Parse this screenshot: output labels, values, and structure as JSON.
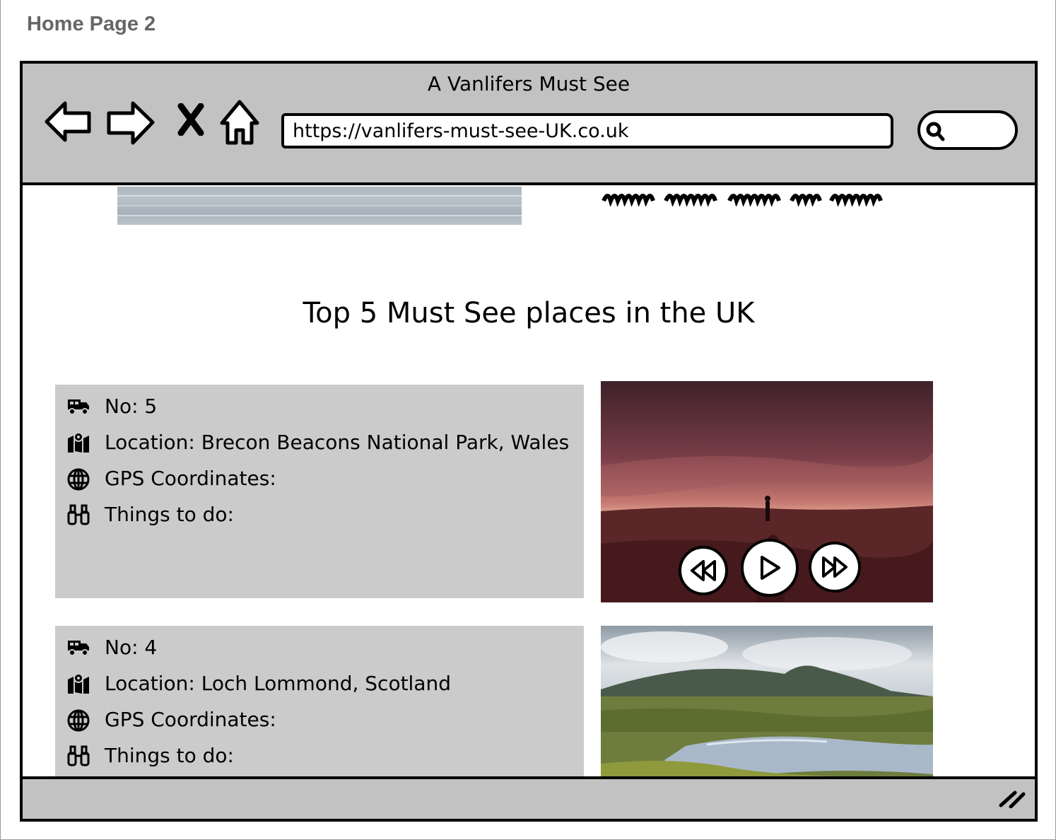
{
  "page": {
    "label": "Home Page 2"
  },
  "browser": {
    "title": "A Vanlifers Must See",
    "url": "https://vanlifers-must-see-UK.co.uk",
    "nav": {
      "back_icon": "arrow-left-icon",
      "forward_icon": "arrow-right-icon",
      "stop_icon": "close-icon",
      "home_icon": "home-icon"
    },
    "search_icon": "search-icon"
  },
  "main": {
    "heading": "Top 5 Must See places in the UK",
    "places": [
      {
        "no": "No: 5",
        "location": "Location: Brecon Beacons National Park, Wales",
        "gps": "GPS Coordinates:",
        "todo": "Things to do:",
        "image": "brecon-beacons-sunset-photo",
        "controls": [
          "rewind-icon",
          "play-icon",
          "fast-forward-icon"
        ]
      },
      {
        "no": "No: 4",
        "location": "Location: Loch Lommond, Scotland",
        "gps": "GPS Coordinates:",
        "todo": "Things to do:",
        "image": "loch-lomond-landscape-photo"
      }
    ],
    "row_icons": [
      "van-icon",
      "map-pin-icon",
      "globe-icon",
      "binoculars-icon"
    ]
  },
  "colors": {
    "chrome": "#c2c2c2",
    "card": "#cbcbcb",
    "page_label": "#666666"
  }
}
